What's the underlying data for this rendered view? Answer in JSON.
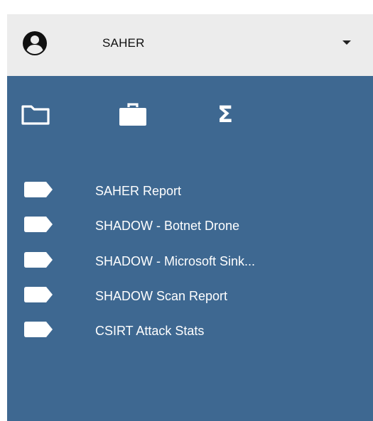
{
  "user": {
    "name": "SAHER"
  },
  "tabs": [
    {
      "icon": "folder-icon"
    },
    {
      "icon": "briefcase-icon"
    },
    {
      "icon": "sigma-icon",
      "glyph": "Σ"
    }
  ],
  "reports": [
    {
      "label": "SAHER Report",
      "icon": "tag-icon"
    },
    {
      "label": "SHADOW - Botnet Drone",
      "icon": "tag-icon"
    },
    {
      "label": "SHADOW - Microsoft Sink...",
      "icon": "tag-icon"
    },
    {
      "label": "SHADOW Scan Report",
      "icon": "tag-icon"
    },
    {
      "label": "CSIRT Attack Stats",
      "icon": "tag-icon"
    }
  ],
  "colors": {
    "header_bg": "#ececec",
    "panel_bg": "#3e6891",
    "icon_fill": "#ffffff",
    "text_light": "#ffffff",
    "text_dark": "#111111"
  }
}
